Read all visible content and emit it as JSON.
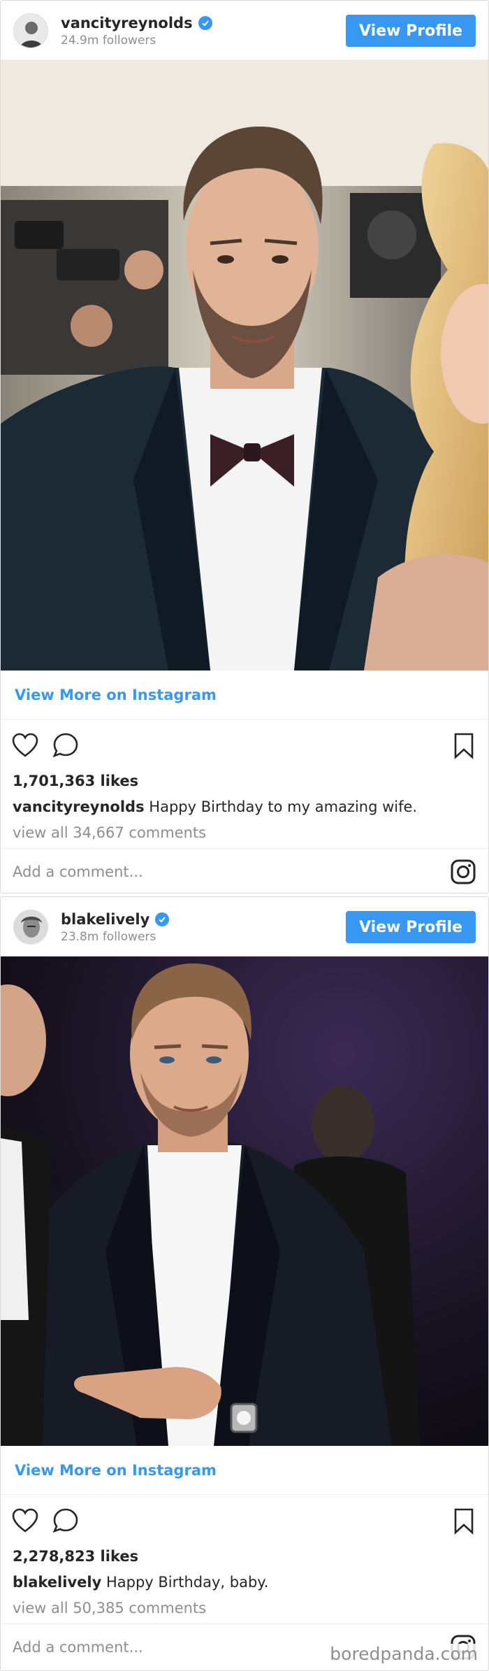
{
  "posts": [
    {
      "username": "vancityreynolds",
      "followers": "24.9m followers",
      "view_profile_label": "View Profile",
      "view_more_label": "View More on Instagram",
      "likes": "1,701,363 likes",
      "caption_user": "vancityreynolds",
      "caption_text": "Happy Birthday to my amazing wife.",
      "comments_link": "view all 34,667 comments",
      "add_comment_placeholder": "Add a comment..."
    },
    {
      "username": "blakelively",
      "followers": "23.8m followers",
      "view_profile_label": "View Profile",
      "view_more_label": "View More on Instagram",
      "likes": "2,278,823 likes",
      "caption_user": "blakelively",
      "caption_text": "Happy Birthday, baby.",
      "comments_link": "view all 50,385 comments",
      "add_comment_placeholder": "Add a comment..."
    }
  ],
  "icons": {
    "like": "heart-icon",
    "comment": "comment-icon",
    "save": "bookmark-icon",
    "instagram": "instagram-icon",
    "verified": "verified-badge-icon"
  },
  "colors": {
    "accent": "#3897f0",
    "muted": "#8e8e8e",
    "border": "#dbdbdb"
  },
  "watermark": "boredpanda.com"
}
